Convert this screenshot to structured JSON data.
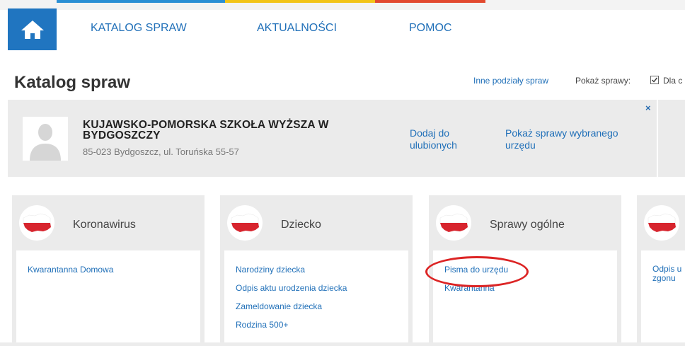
{
  "colors": {
    "brand_blue": "#2075c0",
    "link_blue": "#1f6fb8",
    "strip_blue": "#2a8fd4",
    "strip_yellow": "#f2c418",
    "strip_red": "#e2492f",
    "panel_gray": "#ebebeb",
    "highlight_red": "#dc2424"
  },
  "nav": {
    "home_icon": "home-icon",
    "links": [
      "KATALOG SPRAW",
      "AKTUALNOŚCI",
      "POMOC"
    ]
  },
  "header": {
    "title": "Katalog spraw",
    "other_divisions_link": "Inne podziały spraw",
    "show_cases_label": "Pokaż sprawy:",
    "checkbox_checked": true,
    "checkbox_label": "Dla c"
  },
  "office": {
    "avatar_icon": "person-placeholder-icon",
    "name": "KUJAWSKO-POMORSKA SZKOŁA WYŻSZA W BYDGOSZCZY",
    "address": "85-023 Bydgoszcz, ul. Toruńska 55-57",
    "add_favorites": "Dodaj do ulubionych",
    "show_office_cases": "Pokaż sprawy wybranego urzędu",
    "close_label": "×"
  },
  "categories": [
    {
      "title": "Koronawirus",
      "links": [
        "Kwarantanna Domowa"
      ]
    },
    {
      "title": "Dziecko",
      "links": [
        "Narodziny dziecka",
        "Odpis aktu urodzenia dziecka",
        "Zameldowanie dziecka",
        "Rodzina 500+"
      ]
    },
    {
      "title": "Sprawy ogólne",
      "links": [
        "Pisma do urzędu",
        "Kwarantanna"
      ]
    },
    {
      "title": "",
      "links": [
        "Odpis u zgonu"
      ]
    }
  ]
}
